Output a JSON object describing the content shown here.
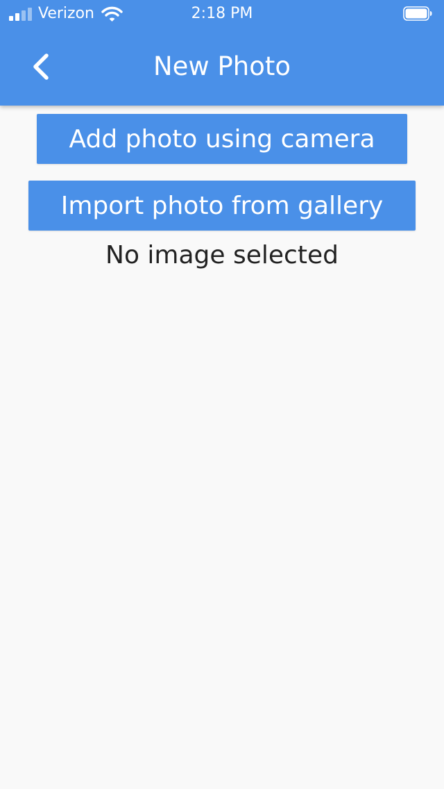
{
  "status_bar": {
    "carrier": "Verizon",
    "time": "2:18 PM",
    "signal_bars_filled": 2,
    "signal_bars_total": 4,
    "signal_icon": "cellular-signal-icon",
    "wifi_icon": "wifi-icon",
    "battery_icon": "battery-icon",
    "battery_level": 1.0
  },
  "app_bar": {
    "title": "New Photo",
    "back_icon": "chevron-left-icon",
    "color": "#4A90E8"
  },
  "actions": {
    "camera_label": "Add photo using camera",
    "gallery_label": "Import photo from gallery"
  },
  "content": {
    "status_text": "No image selected"
  },
  "colors": {
    "primary": "#4A90E8",
    "background": "#F9F9F9",
    "text": "#222222"
  }
}
